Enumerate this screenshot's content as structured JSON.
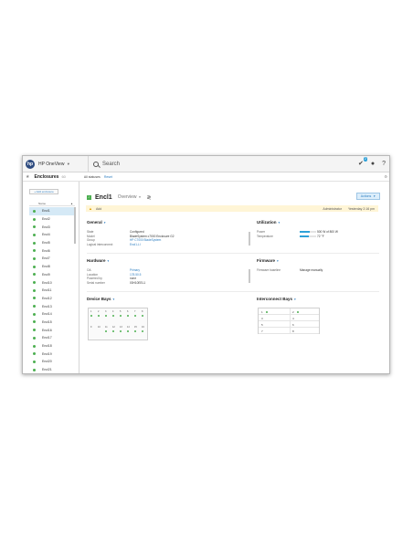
{
  "topbar": {
    "app_name": "HP OneView",
    "logo_text": "hp",
    "search_placeholder": "Search",
    "notification_count": "2"
  },
  "navbar": {
    "title": "Enclosures",
    "count": "60",
    "filter_text": "All statuses",
    "reset_label": "Reset"
  },
  "sidebar": {
    "add_label": "+ Add enclosure",
    "column_name": "Name",
    "items": [
      "Encl1",
      "Encl2",
      "Encl3",
      "Encl4",
      "Encl5",
      "Encl6",
      "Encl7",
      "Encl8",
      "Encl9",
      "Encl10",
      "Encl11",
      "Encl12",
      "Encl13",
      "Encl14",
      "Encl15",
      "Encl16",
      "Encl17",
      "Encl18",
      "Encl19",
      "Encl20",
      "Encl21"
    ]
  },
  "main": {
    "enclosure_name": "Encl1",
    "view_label": "Overview",
    "actions_label": "Actions",
    "alert": {
      "label": "Add",
      "role": "Administrator",
      "time": "Yesterday 2:16 pm"
    },
    "general": {
      "title": "General",
      "rows": [
        {
          "key": "State",
          "value": "Configured"
        },
        {
          "key": "Model",
          "value": "BladeSystem c7000 Enclosure G2"
        },
        {
          "key": "Group",
          "value": "HP C7000 BladeSystem"
        },
        {
          "key": "Logical interconnect",
          "value": "Encl1-LI"
        }
      ]
    },
    "utilization": {
      "title": "Utilization",
      "rows": [
        {
          "key": "Power",
          "value": "500 W of 800 W",
          "fraction": 0.62
        },
        {
          "key": "Temperature",
          "value": "72 °F",
          "fraction": 0.55
        }
      ]
    },
    "hardware": {
      "title": "Hardware",
      "rows": [
        {
          "key": "OA",
          "value": "Primary"
        },
        {
          "key": "Location",
          "value": "178.50.5"
        },
        {
          "key": "Powered by",
          "value": "none"
        },
        {
          "key": "Serial number",
          "value": "00H10EEL1"
        }
      ]
    },
    "firmware": {
      "title": "Firmware",
      "key": "Firmware baseline",
      "value": "Manage manually"
    },
    "device_bays": {
      "title": "Device Bays",
      "top": [
        "1",
        "2",
        "3",
        "4",
        "5",
        "6",
        "7",
        "8"
      ],
      "bottom": [
        "9",
        "10",
        "11",
        "12",
        "13",
        "14",
        "15",
        "16"
      ]
    },
    "interconnect_bays": {
      "title": "Interconnect Bays",
      "rows": [
        [
          "1",
          "2"
        ],
        [
          "3",
          "4"
        ],
        [
          "5",
          "6"
        ],
        [
          "7",
          "8"
        ]
      ]
    }
  }
}
